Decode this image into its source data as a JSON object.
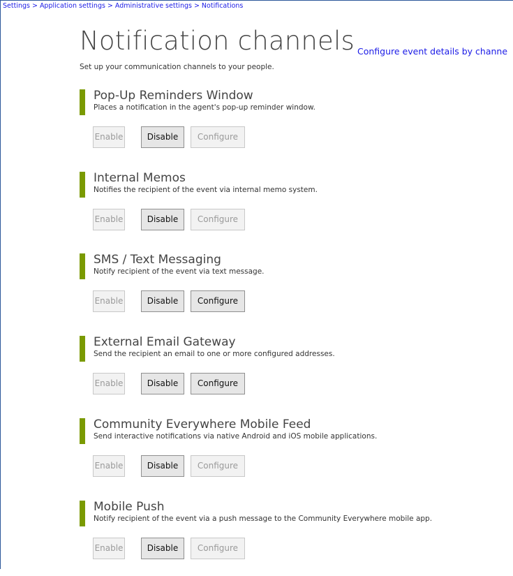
{
  "breadcrumb": [
    "Settings",
    "Application settings",
    "Administrative settings",
    "Notifications"
  ],
  "breadcrumb_separator": ">",
  "page": {
    "title": "Notification channels",
    "subtitle": "Set up your communication channels to your people.",
    "config_link": "Configure event details by channe"
  },
  "accent_color": "#7a9a01",
  "link_color": "#1a1ae6",
  "buttons": {
    "enable": "Enable",
    "disable": "Disable",
    "configure": "Configure"
  },
  "channels": [
    {
      "title": "Pop-Up Reminders Window",
      "description": "Places a notification in the agent's pop-up reminder window.",
      "enable_active": false,
      "disable_active": true,
      "configure_active": false
    },
    {
      "title": "Internal Memos",
      "description": "Notifies the recipient of the event via internal memo system.",
      "enable_active": false,
      "disable_active": true,
      "configure_active": false
    },
    {
      "title": "SMS / Text Messaging",
      "description": "Notify recipient of the event via text message.",
      "enable_active": false,
      "disable_active": true,
      "configure_active": true
    },
    {
      "title": "External Email Gateway",
      "description": "Send the recipient an email to one or more configured addresses.",
      "enable_active": false,
      "disable_active": true,
      "configure_active": true
    },
    {
      "title": "Community Everywhere Mobile Feed",
      "description": "Send interactive notifications via native Android and iOS mobile applications.",
      "enable_active": false,
      "disable_active": true,
      "configure_active": false
    },
    {
      "title": "Mobile Push",
      "description": "Notify recipient of the event via a push message to the Community Everywhere mobile app.",
      "enable_active": false,
      "disable_active": true,
      "configure_active": false
    }
  ]
}
